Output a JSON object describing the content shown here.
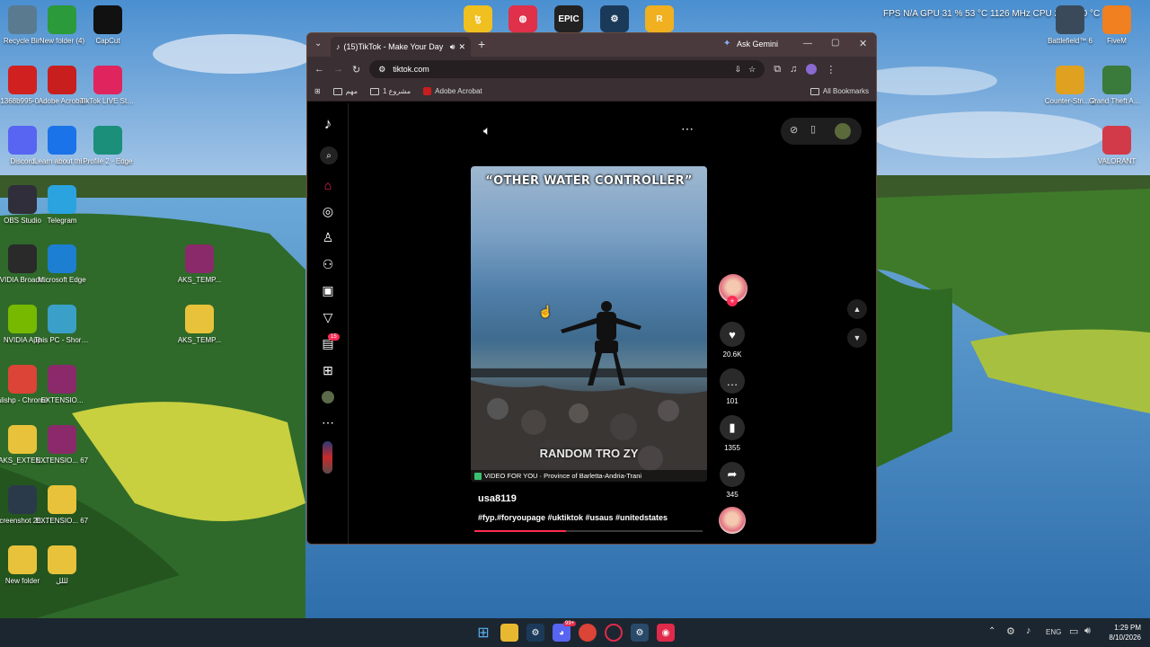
{
  "desktop": {
    "left_icons": [
      {
        "label": "Recycle Bin",
        "icon": "recycle-bin-icon",
        "color": "#5a7a90"
      },
      {
        "label": "New folder (4)",
        "icon": "folder-icon",
        "color": "#2a9a3a"
      },
      {
        "label": "CapCut",
        "icon": "capcut-icon",
        "color": "#111111"
      },
      {
        "label": "1368b995-0...",
        "icon": "pdf-icon",
        "color": "#d02020"
      },
      {
        "label": "Adobe Acrobat",
        "icon": "acrobat-icon",
        "color": "#c81e1e"
      },
      {
        "label": "TikTok LIVE Studio",
        "icon": "tiktok-live-icon",
        "color": "#e0245e"
      },
      {
        "label": "Discord",
        "icon": "discord-icon",
        "color": "#5865f2"
      },
      {
        "label": "Learn about this picture",
        "icon": "info-icon",
        "color": "#1a73e8"
      },
      {
        "label": "Profile 2 - Edge",
        "icon": "edge-icon",
        "color": "#1b8f7a"
      },
      {
        "label": "OBS Studio",
        "icon": "obs-icon",
        "color": "#302e3a"
      },
      {
        "label": "Telegram",
        "icon": "telegram-icon",
        "color": "#2aa3df"
      },
      {
        "label": "NVIDIA Broadcast",
        "icon": "nvidia-broadcast-icon",
        "color": "#2a2a2a"
      },
      {
        "label": "Microsoft Edge",
        "icon": "edge-icon",
        "color": "#1c7fd2"
      },
      {
        "label": "AKS_TEMP...",
        "icon": "winrar-icon",
        "color": "#8a2a6a"
      },
      {
        "label": "NVIDIA App",
        "icon": "nvidia-icon",
        "color": "#76b900"
      },
      {
        "label": "This PC - Shortcut",
        "icon": "pc-icon",
        "color": "#3aa0c8"
      },
      {
        "label": "AKS_TEMP...",
        "icon": "folder-icon",
        "color": "#e8c23a"
      },
      {
        "label": "alishp - Chrome",
        "icon": "chrome-icon",
        "color": "#db4437"
      },
      {
        "label": "EXTENSIO...",
        "icon": "winrar-icon",
        "color": "#8a2a6a"
      },
      {
        "label": "AKS_EXTEN...",
        "icon": "folder-icon",
        "color": "#e8c23a"
      },
      {
        "label": "EXTENSIO... 67",
        "icon": "winrar-icon",
        "color": "#8a2a6a"
      },
      {
        "label": "Screenshot 2025-12-...",
        "icon": "screenshot-icon",
        "color": "#2a3a4a"
      },
      {
        "label": "EXTENSIO... 67",
        "icon": "folder-icon",
        "color": "#e8c23a"
      },
      {
        "label": "New folder",
        "icon": "folder-icon",
        "color": "#e8c23a"
      },
      {
        "label": "لللل",
        "icon": "folder-icon",
        "color": "#e8c23a"
      }
    ],
    "right_icons": [
      {
        "label": "Battlefield™ 6",
        "icon": "battlefield-icon",
        "color": "#3a4a5a"
      },
      {
        "label": "FiveM",
        "icon": "fivem-icon",
        "color": "#f08020"
      },
      {
        "label": "Counter-Stri... 2",
        "icon": "cs2-icon",
        "color": "#e0a020"
      },
      {
        "label": "Grand Theft Auto V Le...",
        "icon": "gta-icon",
        "color": "#3a7a3a"
      },
      {
        "label": "VALORANT",
        "icon": "valorant-icon",
        "color": "#d23a4a"
      }
    ],
    "top_icons": [
      {
        "icon": "tezos-icon",
        "color": "#f0c020",
        "glyph": "ꜩ"
      },
      {
        "icon": "faceit-icon",
        "color": "#e0304a",
        "glyph": "◍"
      },
      {
        "icon": "epic-games-icon",
        "color": "#222222",
        "glyph": "EPIC"
      },
      {
        "icon": "steam-icon",
        "color": "#1b3a5a",
        "glyph": "⚙"
      },
      {
        "icon": "rockstar-icon",
        "color": "#f0b020",
        "glyph": "R"
      }
    ],
    "hud": "FPS  N/A   GPU  31 %  53 °C  1126 MHz   CPU  27 %  40 °C"
  },
  "browser": {
    "tab_title": "(15)TikTok - Make Your Day",
    "ask_gemini": "Ask Gemini",
    "url": "tiktok.com",
    "bookmarks": [
      "مهم",
      "مشروع 1",
      "Adobe Acrobat"
    ],
    "all_bookmarks": "All Bookmarks"
  },
  "tiktok": {
    "notification_count": "15",
    "video_caption_top": "“OTHER WATER CONTROLLER”",
    "video_caption_bottom": "RANDOM TRO ZY",
    "location": "VIDEO FOR YOU · Province of Barletta-Andria-Trani",
    "username": "usa8119",
    "hashtags": "#fyp.#foryoupage #uktiktok #usaus #unitedstates",
    "likes": "20.6K",
    "comments": "101",
    "saves": "1355",
    "shares": "345",
    "progress": 0.4
  },
  "taskbar": {
    "lang": "ENG",
    "time": "1:29 PM",
    "date": "8/10/2026",
    "discord_badge": "99+"
  }
}
